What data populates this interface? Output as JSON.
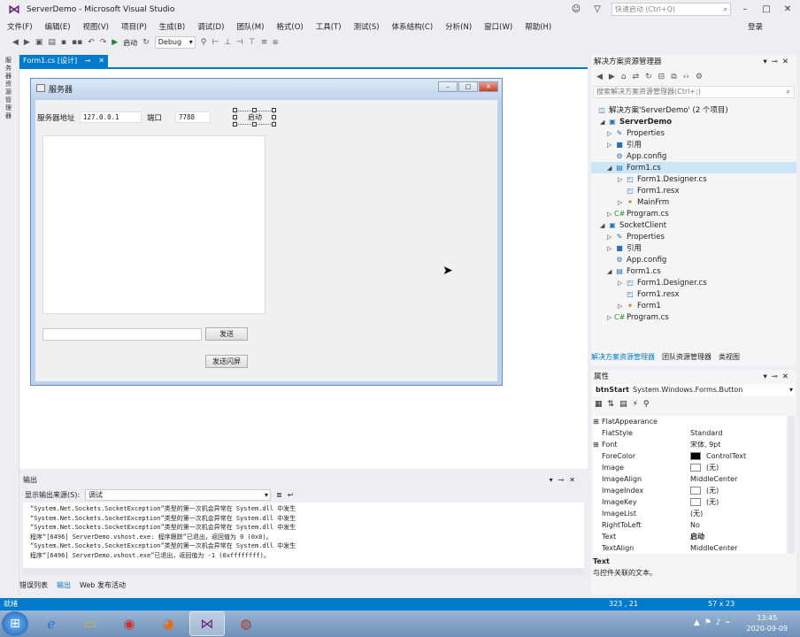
{
  "titlebar": {
    "title": "ServerDemo - Microsoft Visual Studio",
    "quick_launch_placeholder": "快速启动 (Ctrl+Q)"
  },
  "menu": [
    "文件(F)",
    "编辑(E)",
    "视图(V)",
    "项目(P)",
    "生成(B)",
    "调试(D)",
    "团队(M)",
    "格式(O)",
    "工具(T)",
    "测试(S)",
    "体系结构(C)",
    "分析(N)",
    "窗口(W)",
    "帮助(H)"
  ],
  "login_label": "登录",
  "toolbar": {
    "start_label": "启动",
    "config": "Debug"
  },
  "left_strip_label": "服务器资源管理器",
  "doc_tab": {
    "label": "Form1.cs [设计]"
  },
  "form": {
    "title": "服务器",
    "address_label": "服务器地址",
    "address_value": "127.0.0.1",
    "port_label": "端口",
    "port_value": "7788",
    "start_button": "启动",
    "send_button": "发送",
    "shake_button": "发送闪屏"
  },
  "output": {
    "title": "输出",
    "source_label": "显示输出来源(S):",
    "source_value": "调试",
    "lines": [
      "“System.Net.Sockets.SocketException”类型的第一次机会异常在 System.dll 中发生",
      "“System.Net.Sockets.SocketException”类型的第一次机会异常在 System.dll 中发生",
      "“System.Net.Sockets.SocketException”类型的第一次机会异常在 System.dll 中发生",
      "程序“[6496] ServerDemo.vshost.exe: 程序跟踪”已退出，返回值为 0 (0x0)。",
      "“System.Net.Sockets.SocketException”类型的第一次机会异常在 System.dll 中发生",
      "程序“[6496] ServerDemo.vshost.exe”已退出，返回值为 -1 (0xffffffff)。"
    ]
  },
  "bottom_tabs": [
    "错误列表",
    "输出",
    "Web 发布活动"
  ],
  "solution_explorer": {
    "title": "解决方案资源管理器",
    "search_placeholder": "搜索解决方案资源管理器(Ctrl+;)",
    "nodes": [
      {
        "label": "解决方案'ServerDemo' (2 个项目)",
        "icon": "solution-icon"
      },
      {
        "label": "ServerDemo",
        "icon": "csharp-project-icon"
      },
      {
        "label": "Properties",
        "icon": "wrench-icon"
      },
      {
        "label": "引用",
        "icon": "references-icon"
      },
      {
        "label": "App.config",
        "icon": "config-file-icon"
      },
      {
        "label": "Form1.cs",
        "icon": "form-icon"
      },
      {
        "label": "Form1.Designer.cs",
        "icon": "csharp-file-icon"
      },
      {
        "label": "Form1.resx",
        "icon": "resx-file-icon"
      },
      {
        "label": "MainFrm",
        "icon": "class-icon"
      },
      {
        "label": "Program.cs",
        "icon": "csharp-file-icon"
      },
      {
        "label": "SocketClient",
        "icon": "csharp-project-icon"
      },
      {
        "label": "Properties",
        "icon": "wrench-icon"
      },
      {
        "label": "引用",
        "icon": "references-icon"
      },
      {
        "label": "App.config",
        "icon": "config-file-icon"
      },
      {
        "label": "Form1.cs",
        "icon": "form-icon"
      },
      {
        "label": "Form1.Designer.cs",
        "icon": "csharp-file-icon"
      },
      {
        "label": "Form1.resx",
        "icon": "resx-file-icon"
      },
      {
        "label": "Form1",
        "icon": "class-icon"
      },
      {
        "label": "Program.cs",
        "icon": "csharp-file-icon"
      }
    ],
    "tabs": [
      "解决方案资源管理器",
      "团队资源管理器",
      "类视图"
    ]
  },
  "properties": {
    "title": "属性",
    "object_name": "btnStart",
    "object_type": "System.Windows.Forms.Button",
    "rows": [
      {
        "name": "FlatAppearance",
        "value": ""
      },
      {
        "name": "FlatStyle",
        "value": "Standard"
      },
      {
        "name": "Font",
        "value": "宋体, 9pt"
      },
      {
        "name": "ForeColor",
        "value": "ControlText"
      },
      {
        "name": "Image",
        "value": "(无)"
      },
      {
        "name": "ImageAlign",
        "value": "MiddleCenter"
      },
      {
        "name": "ImageIndex",
        "value": "(无)"
      },
      {
        "name": "ImageKey",
        "value": "(无)"
      },
      {
        "name": "ImageList",
        "value": "(无)"
      },
      {
        "name": "RightToLeft",
        "value": "No"
      },
      {
        "name": "Text",
        "value": "启动"
      },
      {
        "name": "TextAlign",
        "value": "MiddleCenter"
      }
    ],
    "desc_name": "Text",
    "desc_text": "与控件关联的文本。"
  },
  "statusbar": {
    "text": "就绪",
    "position": "323 , 21",
    "size": "57 x 23"
  },
  "clock": {
    "time": "13:45",
    "date": "2020-09-09"
  },
  "colors": {
    "accent": "#007acc",
    "vs_purple": "#68217a"
  }
}
